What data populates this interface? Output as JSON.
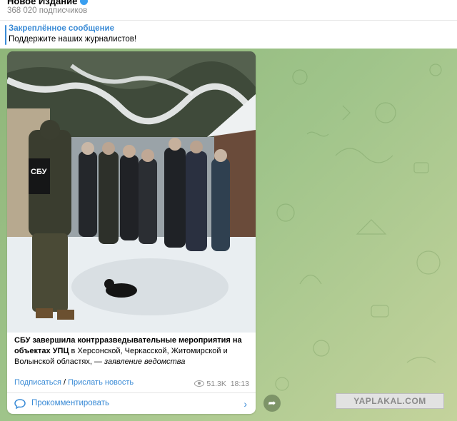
{
  "channel": {
    "name": "Новое Издание",
    "subscribers": "368 020 подписчиков"
  },
  "pinned": {
    "title": "Закреплённое сообщение",
    "text": "Поддержите наших журналистов!"
  },
  "post": {
    "photo_patch_text": "СБУ",
    "caption_bold_line1": "СБУ завершила контрразведывательные мероприятия на",
    "caption_bold_line2": "объектах УПЦ",
    "caption_rest": " в Херсонской, Черкасской, Житомирской и Волынской областях, — ",
    "caption_italic": "заявление ведомства",
    "link_subscribe": "Подписаться",
    "link_separator": " / ",
    "link_send_news": "Прислать новость",
    "views": "51.3K",
    "time": "18:13",
    "comments_label": "Прокомментировать"
  },
  "watermark": "YAPLAKAL.COM",
  "icons": {
    "verified": "verified-badge-icon",
    "views": "eye-icon",
    "comments": "comment-icon",
    "chevron": "chevron-right-icon",
    "forward": "share-arrow-icon"
  },
  "colors": {
    "accent": "#3a8bd6",
    "chat_bg": "#9fc48a"
  }
}
